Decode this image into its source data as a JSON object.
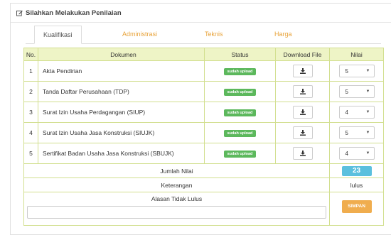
{
  "panel": {
    "title": "Silahkan Melakukan Penilaian"
  },
  "tabs": [
    "Kualifikasi",
    "Administrasi",
    "Teknis",
    "Harga"
  ],
  "table": {
    "headers": {
      "no": "No.",
      "dokumen": "Dokumen",
      "status": "Status",
      "download": "Download File",
      "nilai": "Nilai"
    },
    "rows": [
      {
        "no": "1",
        "dokumen": "Akta Pendirian",
        "status": "sudah upload",
        "nilai": "5"
      },
      {
        "no": "2",
        "dokumen": "Tanda Daftar Perusahaan (TDP)",
        "status": "sudah upload",
        "nilai": "5"
      },
      {
        "no": "3",
        "dokumen": "Surat Izin Usaha Perdagangan (SIUP)",
        "status": "sudah upload",
        "nilai": "4"
      },
      {
        "no": "4",
        "dokumen": "Surat Izin Usaha Jasa Konstruksi (SIUJK)",
        "status": "sudah upload",
        "nilai": "5"
      },
      {
        "no": "5",
        "dokumen": "Sertifikat Badan Usaha Jasa Konstruksi (SBUJK)",
        "status": "sudah upload",
        "nilai": "4"
      }
    ],
    "jumlah_label": "Jumlah Nilai",
    "jumlah_value": "23",
    "keterangan_label": "Keterangan",
    "keterangan_value": "lulus",
    "alasan_label": "Alasan Tidak Lulus",
    "alasan_value": "",
    "save_label": "SIMPAN"
  },
  "colors": {
    "tab_accent": "#e8a33a",
    "status_badge": "#5cb85c",
    "total_badge": "#5bc0de",
    "save_button": "#f0ad4e",
    "table_border": "#d2df8f"
  }
}
